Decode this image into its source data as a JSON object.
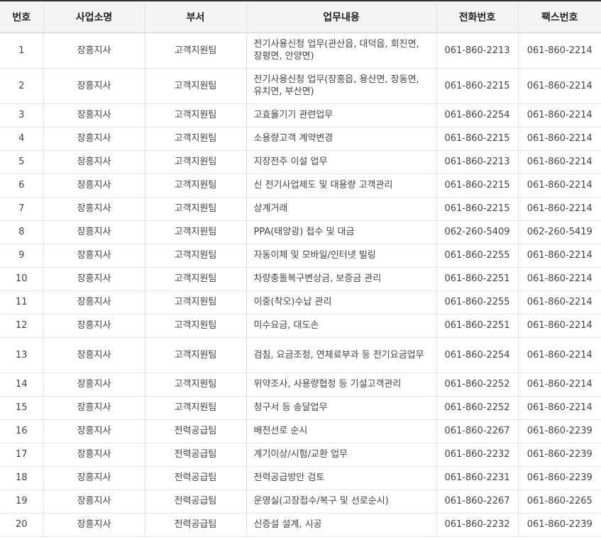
{
  "headers": {
    "no": "번호",
    "office": "사업소명",
    "dept": "부서",
    "task": "업무내용",
    "tel": "전화번호",
    "fax": "팩스번호"
  },
  "rows": [
    {
      "no": "1",
      "office": "장흥지사",
      "dept": "고객지원팀",
      "task": "전기사용신청 업무(관산읍, 대덕읍, 회진면, 장평면, 안양면)",
      "tel": "061-860-2213",
      "fax": "061-860-2214"
    },
    {
      "no": "2",
      "office": "장흥지사",
      "dept": "고객지원팀",
      "task": "전기사용신청 업무(장흥읍, 용산면, 장동면, 유치면, 부산면)",
      "tel": "061-860-2215",
      "fax": "061-860-2214"
    },
    {
      "no": "3",
      "office": "장흥지사",
      "dept": "고객지원팀",
      "task": "고효율기기 관련업무",
      "tel": "061-860-2254",
      "fax": "061-860-2214"
    },
    {
      "no": "4",
      "office": "장흥지사",
      "dept": "고객지원팀",
      "task": "소용량고객 계약변경",
      "tel": "061-860-2215",
      "fax": "061-860-2214"
    },
    {
      "no": "5",
      "office": "장흥지사",
      "dept": "고객지원팀",
      "task": "지장전주 이설 업무",
      "tel": "061-860-2213",
      "fax": "061-860-2214"
    },
    {
      "no": "6",
      "office": "장흥지사",
      "dept": "고객지원팀",
      "task": "신 전기사업제도 및 대용량 고객관리",
      "tel": "061-860-2215",
      "fax": "061-860-2214"
    },
    {
      "no": "7",
      "office": "장흥지사",
      "dept": "고객지원팀",
      "task": "상계거래",
      "tel": "061-860-2215",
      "fax": "061-860-2214"
    },
    {
      "no": "8",
      "office": "장흥지사",
      "dept": "고객지원팀",
      "task": "PPA(태양광) 접수 및 대금",
      "tel": "062-260-5409",
      "fax": "062-260-5419"
    },
    {
      "no": "9",
      "office": "장흥지사",
      "dept": "고객지원팀",
      "task": "자동이체 및 모바일/인터넷 빌링",
      "tel": "061-860-2255",
      "fax": "061-860-2214"
    },
    {
      "no": "10",
      "office": "장흥지사",
      "dept": "고객지원팀",
      "task": "차량충돌복구변상금, 보증금 관리",
      "tel": "061-860-2251",
      "fax": "061-860-2214"
    },
    {
      "no": "11",
      "office": "장흥지사",
      "dept": "고객지원팀",
      "task": "이중(착오)수납 관리",
      "tel": "061-860-2255",
      "fax": "061-860-2214"
    },
    {
      "no": "12",
      "office": "장흥지사",
      "dept": "고객지원팀",
      "task": "미수요금, 대도손",
      "tel": "061-860-2251",
      "fax": "061-860-2214"
    },
    {
      "no": "13",
      "office": "장흥지사",
      "dept": "고객지원팀",
      "task": "검침, 요금조정, 연체료부과 등 전기요금업무",
      "tel": "061-860-2254",
      "fax": "061-860-2214"
    },
    {
      "no": "14",
      "office": "장흥지사",
      "dept": "고객지원팀",
      "task": "위약조사, 사용량협정 등 기설고객관리",
      "tel": "061-860-2252",
      "fax": "061-860-2214"
    },
    {
      "no": "15",
      "office": "장흥지사",
      "dept": "고객지원팀",
      "task": "청구서 등 송달업무",
      "tel": "061-860-2252",
      "fax": "061-860-2214"
    },
    {
      "no": "16",
      "office": "장흥지사",
      "dept": "전력공급팀",
      "task": "배전선로 순시",
      "tel": "061-860-2267",
      "fax": "061-860-2239"
    },
    {
      "no": "17",
      "office": "장흥지사",
      "dept": "전력공급팀",
      "task": "계기이상/시험/교환 업무",
      "tel": "061-860-2232",
      "fax": "061-860-2239"
    },
    {
      "no": "18",
      "office": "장흥지사",
      "dept": "전력공급팀",
      "task": "전력공급방안 검토",
      "tel": "061-860-2231",
      "fax": "061-860-2239"
    },
    {
      "no": "19",
      "office": "장흥지사",
      "dept": "전력공급팀",
      "task": "운영실(고장접수/복구 및 선로순시)",
      "tel": "061-860-2267",
      "fax": "061-860-2265"
    },
    {
      "no": "20",
      "office": "장흥지사",
      "dept": "전력공급팀",
      "task": "신증설 설계, 시공",
      "tel": "061-860-2232",
      "fax": "061-860-2239"
    }
  ]
}
